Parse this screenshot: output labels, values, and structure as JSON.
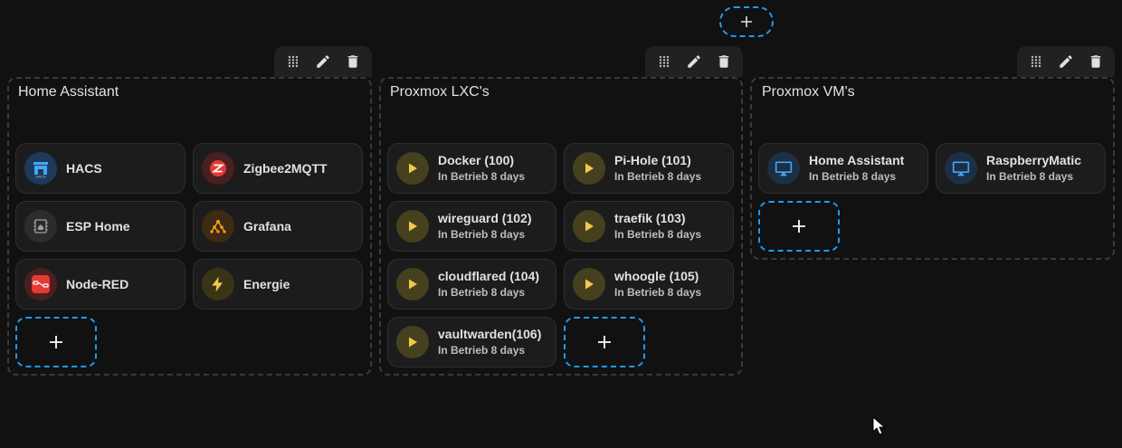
{
  "colors": {
    "background": "#111111",
    "accent_blue": "#1e9bf0",
    "play_yellow": "#f2c94c",
    "monitor_blue": "#42a5f5"
  },
  "top_add": {
    "icon": "plus-icon"
  },
  "toolbar_icons": [
    "drag-handle-icon",
    "pencil-icon",
    "trash-icon"
  ],
  "sections": [
    {
      "title": "Home Assistant",
      "tiles": [
        {
          "name": "HACS",
          "icon": "hacs-icon"
        },
        {
          "name": "Zigbee2MQTT",
          "icon": "zigbee-icon"
        },
        {
          "name": "ESP Home",
          "icon": "esphome-icon"
        },
        {
          "name": "Grafana",
          "icon": "grafana-icon"
        },
        {
          "name": "Node-RED",
          "icon": "node-red-icon"
        },
        {
          "name": "Energie",
          "icon": "lightning-icon"
        }
      ]
    },
    {
      "title": "Proxmox LXC's",
      "tiles": [
        {
          "name": "Docker (100)",
          "state": "In Betrieb 8 days",
          "icon": "play-icon"
        },
        {
          "name": "Pi-Hole (101)",
          "state": "In Betrieb 8 days",
          "icon": "play-icon"
        },
        {
          "name": "wireguard (102)",
          "state": "In Betrieb 8 days",
          "icon": "play-icon"
        },
        {
          "name": "traefik (103)",
          "state": "In Betrieb 8 days",
          "icon": "play-icon"
        },
        {
          "name": "cloudflared (104)",
          "state": "In Betrieb 8 days",
          "icon": "play-icon"
        },
        {
          "name": "whoogle (105)",
          "state": "In Betrieb 8 days",
          "icon": "play-icon"
        },
        {
          "name": "vaultwarden(106)",
          "state": "In Betrieb 8 days",
          "icon": "play-icon"
        }
      ]
    },
    {
      "title": "Proxmox VM's",
      "tiles": [
        {
          "name": "Home Assistant",
          "state": "In Betrieb 8 days",
          "icon": "monitor-icon"
        },
        {
          "name": "RaspberryMatic",
          "state": "In Betrieb 8 days",
          "icon": "monitor-icon"
        }
      ]
    }
  ]
}
